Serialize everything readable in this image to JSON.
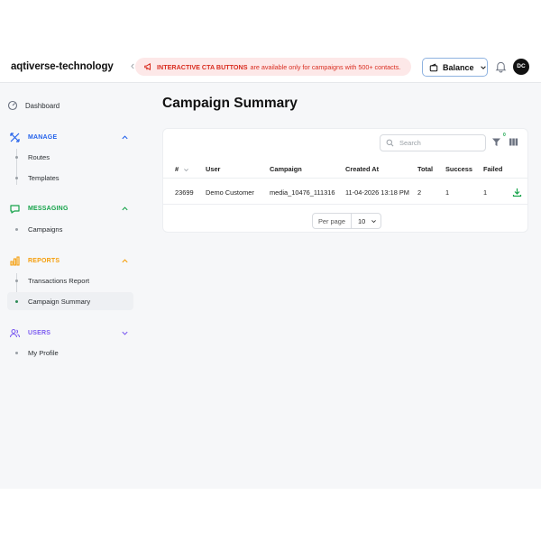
{
  "header": {
    "brand": "aqtiverse-technology",
    "banner_strong": "INTERACTIVE CTA BUTTONS",
    "banner_text": "are available only for campaigns with 500+ contacts.",
    "balance_label": "Balance",
    "avatar_initials": "DC"
  },
  "sidebar": {
    "dashboard": "Dashboard",
    "manage": {
      "label": "MANAGE",
      "color": "#2563eb",
      "items": [
        "Routes",
        "Templates"
      ]
    },
    "messaging": {
      "label": "MESSAGING",
      "color": "#16a34a",
      "items": [
        "Campaigns"
      ]
    },
    "reports": {
      "label": "REPORTS",
      "color": "#f59e0b",
      "items": [
        "Transactions Report",
        "Campaign Summary"
      ],
      "active": "Campaign Summary"
    },
    "users": {
      "label": "USERS",
      "color": "#7c5cf0",
      "items": [
        "My Profile"
      ]
    }
  },
  "main": {
    "title": "Campaign Summary",
    "search_placeholder": "Search",
    "filter_count": "0",
    "columns": [
      "#",
      "User",
      "Campaign",
      "Created At",
      "Total",
      "Success",
      "Failed"
    ],
    "rows": [
      {
        "id": "23699",
        "user": "Demo Customer",
        "campaign": "media_10476_111316",
        "created_at": "11-04-2026 13:18 PM",
        "total": "2",
        "success": "1",
        "failed": "1"
      }
    ],
    "per_page_label": "Per page",
    "per_page_value": "10"
  }
}
